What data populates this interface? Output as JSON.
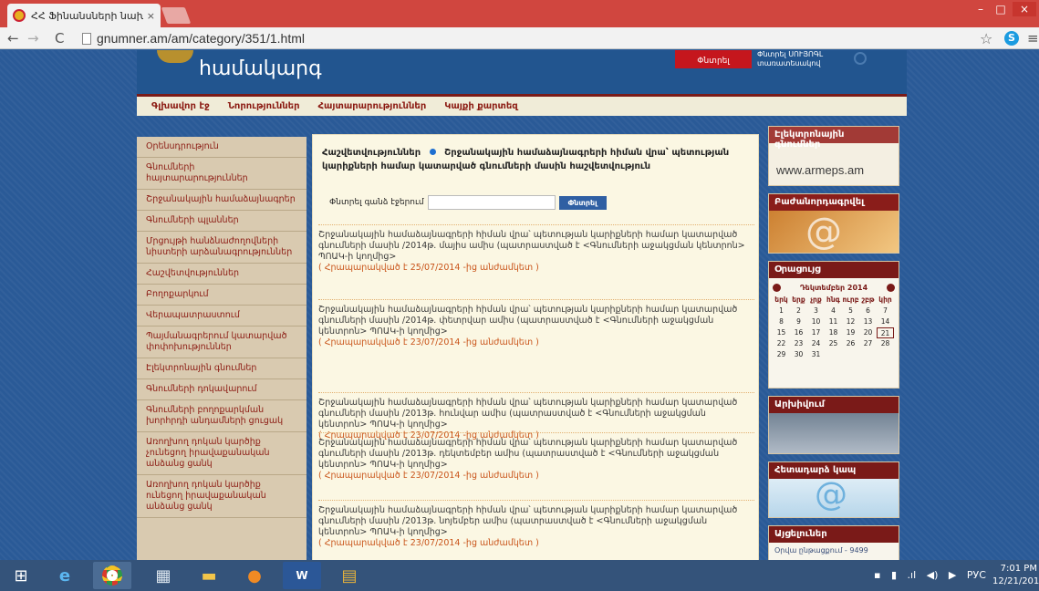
{
  "browser": {
    "tab_title": "ՀՀ Ֆինանսների նախար",
    "tab_close": "×",
    "url": "gnumner.am/am/category/351/1.html",
    "win_min": "–",
    "win_max": "□",
    "win_close": "×"
  },
  "header": {
    "site_title": "համակարգ",
    "search_button": "Փնտրել",
    "search_hint": "Փնտրել ՍՈՒՅՈԳԼ\nտառատեսակով",
    "nav": [
      "Գլխավոր էջ",
      "Նորություններ",
      "Հայտարարություններ",
      "Կայքի քարտեզ"
    ]
  },
  "sidebar": {
    "items": [
      "Օրենսդրություն",
      "Գնումների հայտարարություններ",
      "Շրջանակային համաձայնագրեր",
      "Գնումների պլաններ",
      "Մրցույթի հանձնաժողովների\nնիստերի արձանագրություններ",
      "Հաշվետվություններ",
      "Բողոքարկում",
      "Վերապատրաստում",
      "Պայմանագրերում կատարված\nփոփոխություններ",
      "Էլեկտրոնային գնումներ",
      "Գնումների դոկավարում",
      "Գնումների բողոքարկման\nխորհրդի անդամների ցուցակ",
      "Առողխող դոկան կարծիք\nչունեցող իրավաքանական\nանձանց ցանկ",
      "Առողխող դոկան կարծիք\nունեցող իրավաքանական\nանձանց ցանկ"
    ]
  },
  "main": {
    "breadcrumb_parent": "Հաշվետվություններ",
    "breadcrumb_current": "Շրջանակային համաձայնագրերի հիման վրա՝ պետության կարիքների համար կատարված գնումների մասին հաշվետվություն",
    "search_label": "Փնտրել գանձ էջերում",
    "search_value": "",
    "search_button": "Փնտրել",
    "articles": [
      {
        "title": "Շրջանակային համաձայնագրերի հիման վրա՝ պետության կարիքների համար կատարված գնումների մասին /2014թ. մայիս ամիս (պատրաստված է <Գնումների աջակցման կենտրոն> ՊՈԱԿ-ի կողմից>",
        "date": "( Հրապարակված է 25/07/2014 -ից անժամկետ )"
      },
      {
        "title": "Շրջանակային համաձայնագրերի հիման վրա՝ պետության կարիքների համար կատարված գնումների մասին /2014թ. փետրվար ամիս (պատրաստված է <Գնումների աջակցման կենտրոն> ՊՈԱԿ-ի կողմից>",
        "date": "( Հրապարակված է 23/07/2014 -ից անժամկետ )"
      },
      {
        "title": "Շրջանակային համաձայնագրերի հիման վրա՝ պետության կարիքների համար կատարված գնումների մասին /2013թ. հունվար ամիս (պատրաստված է <Գնումների աջակցման կենտրոն> ՊՈԱԿ-ի կողմից>",
        "date": "( Հրապարակված է 23/07/2014 -ից անժամկետ )"
      },
      {
        "title": "Շրջանակային համաձայնագրերի հիման վրա՝ պետության կարիքների համար կատարված գնումների մասին /2013թ. դեկտեմբեր ամիս (պատրաստված է <Գնումների աջակցման կենտրոն> ՊՈԱԿ-ի կողմից>",
        "date": "( Հրապարակված է 23/07/2014 -ից անժամկետ )"
      },
      {
        "title": "Շրջանակային համաձայնագրերի հիման վրա՝ պետության կարիքների համար կատարված գնումների մասին /2013թ. նոյեմբեր ամիս (պատրաստված է <Գնումների աջակցման կենտրոն> ՊՈԱԿ-ի կողմից>",
        "date": "( Հրապարակված է 23/07/2014 -ից անժամկետ )"
      }
    ]
  },
  "right": {
    "egov_title": "Էլեկտրոնային գնումներ",
    "egov_url": "www.armeps.am",
    "subscribe_title": "Բաժանորդագրվել",
    "calendar_title": "Օրացույց",
    "calendar_month": "Դեկտեմբեր 2014",
    "weekdays": [
      "երկ",
      "երք",
      "չրք",
      "հնգ",
      "ուրբ",
      "շբթ",
      "կիր"
    ],
    "weeks": [
      [
        "1",
        "2",
        "3",
        "4",
        "5",
        "6",
        "7"
      ],
      [
        "8",
        "9",
        "10",
        "11",
        "12",
        "13",
        "14"
      ],
      [
        "15",
        "16",
        "17",
        "18",
        "19",
        "20",
        "21"
      ],
      [
        "22",
        "23",
        "24",
        "25",
        "26",
        "27",
        "28"
      ],
      [
        "29",
        "30",
        "31",
        "",
        "",
        "",
        ""
      ]
    ],
    "today": "21",
    "archive_title": "Արխիվում",
    "feedback_title": "Հետադարձ կապ",
    "stats_title": "Այցելուներ",
    "stats_line": "Օրվա ընթացքում - 9499"
  },
  "taskbar": {
    "lang": "РУС",
    "time": "7:01 PM",
    "date": "12/21/2014"
  }
}
